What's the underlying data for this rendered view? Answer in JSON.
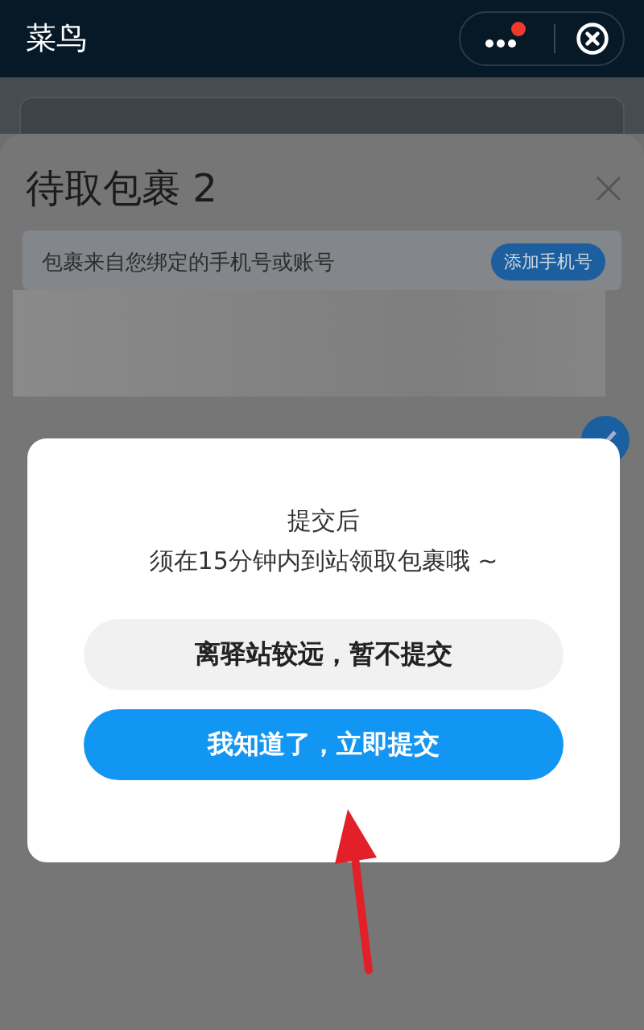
{
  "nav_bar": {
    "title": "菜鸟",
    "more_badge": true
  },
  "sheet": {
    "title": "待取包裹 2",
    "notice": "包裹来自您绑定的手机号或账号",
    "notice_button": "添加手机号",
    "select_all_checked": true
  },
  "dialog": {
    "lines": [
      "提交后",
      "须在15分钟内到站领取包裹哦 ~"
    ],
    "buttons": [
      {
        "label": "离驿站较远，暂不提交",
        "kind": "secondary"
      },
      {
        "label": "我知道了，立即提交",
        "kind": "primary"
      }
    ]
  },
  "annotation": {
    "kind": "arrow"
  }
}
